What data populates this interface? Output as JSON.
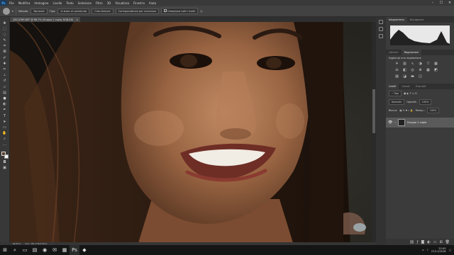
{
  "menubar": {
    "logo": "Ps",
    "items": [
      "File",
      "Modifica",
      "Immagine",
      "Livello",
      "Testo",
      "Selezione",
      "Filtro",
      "3D",
      "Visualizza",
      "Finestra",
      "Aiuto"
    ],
    "window_controls": [
      "–",
      "☐",
      "✕"
    ]
  },
  "options": {
    "mode_label": "Metodo:",
    "mode_value": "Normale",
    "type_label": "Tipo:",
    "option1": "In base al contenuto",
    "option2": "Crea texture",
    "option3": "Corrispondenza per vicinanze",
    "sample_all": "Campiona tutti i livelli"
  },
  "document": {
    "tab_title": "_DSC4789.NEF @ 66,7% (Gruppo 1 copia, RGB/16)",
    "close": "×"
  },
  "status": {
    "zoom": "66,67%",
    "doc_size": "Doc: 181,3 M/2,08 G"
  },
  "panels": {
    "histogram_tabs": [
      "Istogramma",
      "Navigatore"
    ],
    "adjust_tabs": [
      "Librerie",
      "Regolazioni"
    ],
    "adjust_title": "Aggiungi una regolazione",
    "layers_tabs": [
      "Livelli",
      "Canali",
      "Tracciati"
    ],
    "blend_mode": "Normale",
    "opacity_label": "Opacità:",
    "opacity_value": "100%",
    "lock_label": "Blocca:",
    "fill_label": "Riemp.:",
    "fill_value": "100%",
    "layer_name": "Gruppo 1 copia"
  },
  "taskbar": {
    "time": "22:05",
    "date": "27/11/2018"
  },
  "colors": {
    "accent": "#31a8ff",
    "panel": "#3b3b3b",
    "chrome": "#393939"
  }
}
